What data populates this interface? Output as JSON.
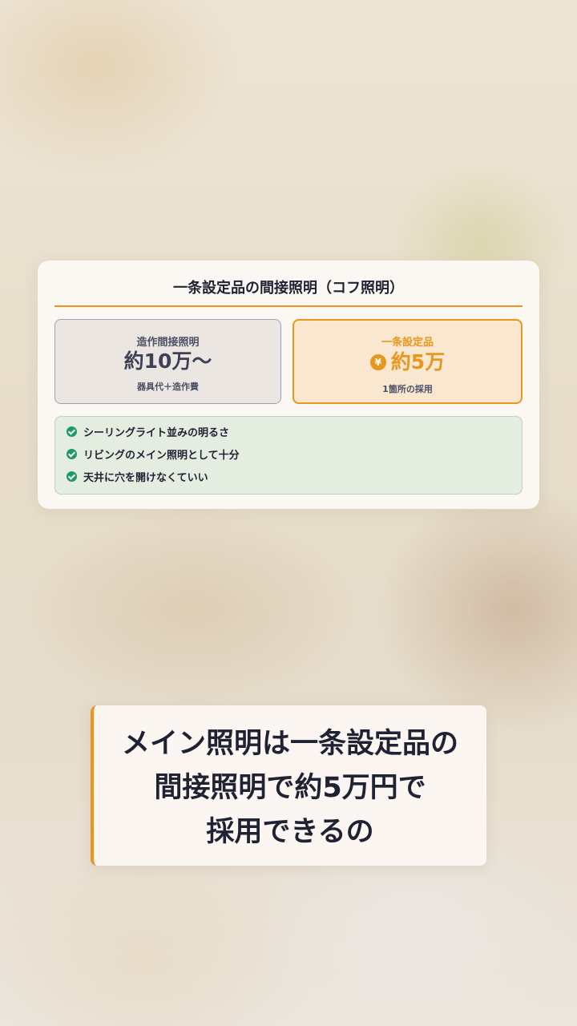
{
  "card": {
    "title": "一条設定品の間接照明（コフ照明）",
    "left_box": {
      "label": "造作間接照明",
      "value": "約10万〜",
      "note": "器具代＋造作費"
    },
    "right_box": {
      "label": "一条設定品",
      "icon": "yen-icon",
      "icon_glyph": "¥",
      "value": "約5万",
      "note": "1箇所の採用"
    },
    "benefits": [
      "シーリングライト並みの明るさ",
      "リビングのメイン照明として十分",
      "天井に穴を開けなくていい"
    ]
  },
  "caption": {
    "lines": [
      "メイン照明は一条設定品の",
      "間接照明で約5万円で",
      "採用できるの"
    ]
  },
  "colors": {
    "accent": "#e8961e",
    "check": "#1e9a67",
    "text": "#1f2233",
    "benefit_bg": "#e5ece0"
  }
}
